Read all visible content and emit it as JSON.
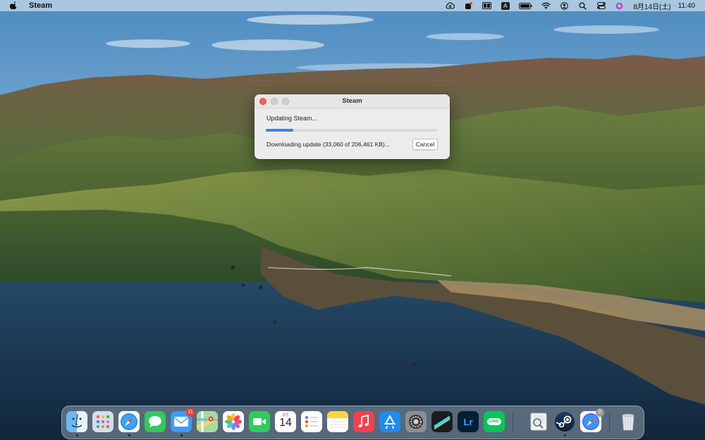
{
  "menubar": {
    "app_name": "Steam",
    "date": "8月14日(土)",
    "time": "11:40",
    "status_icons": [
      "creative-cloud-icon",
      "notification-app-icon",
      "window-layout-icon",
      "input-method-icon",
      "battery-icon",
      "wifi-icon",
      "user-icon",
      "spotlight-search-icon",
      "control-center-icon",
      "siri-icon"
    ],
    "input_method_label": "A"
  },
  "dialog": {
    "title": "Steam",
    "status": "Updating Steam...",
    "detail": "Downloading update (33,060 of 206,461 KB)...",
    "progress_percent": 16,
    "cancel_label": "Cancel"
  },
  "dock": {
    "apps": [
      {
        "name": "finder-icon",
        "running": true
      },
      {
        "name": "launchpad-icon",
        "running": false
      },
      {
        "name": "safari-icon",
        "running": true
      },
      {
        "name": "messages-icon",
        "running": false
      },
      {
        "name": "mail-icon",
        "running": true,
        "badge": "11"
      },
      {
        "name": "maps-icon",
        "running": false
      },
      {
        "name": "photos-icon",
        "running": false
      },
      {
        "name": "facetime-icon",
        "running": false
      },
      {
        "name": "calendar-icon",
        "running": false,
        "month": "8月",
        "day": "14"
      },
      {
        "name": "reminders-icon",
        "running": false
      },
      {
        "name": "notes-icon",
        "running": false
      },
      {
        "name": "music-icon",
        "running": false
      },
      {
        "name": "app-store-icon",
        "running": false
      },
      {
        "name": "system-preferences-icon",
        "running": false
      },
      {
        "name": "final-cut-icon",
        "running": false
      },
      {
        "name": "lightroom-icon",
        "running": false,
        "label": "Lr"
      },
      {
        "name": "line-icon",
        "running": false,
        "label": "LINE"
      },
      {
        "name": "preview-icon",
        "running": false
      },
      {
        "name": "steam-icon",
        "running": true
      },
      {
        "name": "safari-tp-icon",
        "running": false,
        "badge": "0"
      },
      {
        "name": "trash-icon",
        "running": false
      }
    ],
    "accent": "#ff3b30"
  }
}
